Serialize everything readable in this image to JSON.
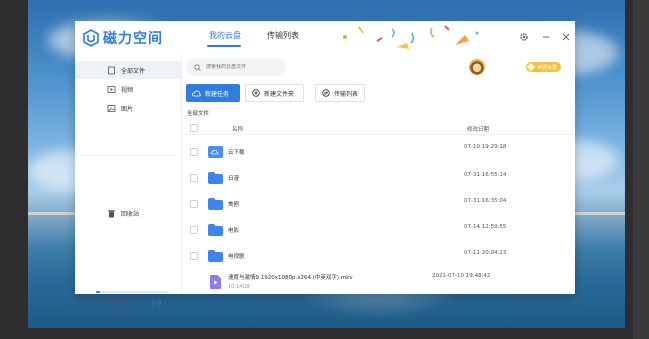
{
  "app": {
    "title": "磁力空间"
  },
  "nav": {
    "tabs": [
      {
        "label": "我的云盘"
      },
      {
        "label": "传输列表"
      }
    ]
  },
  "sidebar": {
    "items": [
      {
        "label": "全部文件"
      },
      {
        "label": "视频"
      },
      {
        "label": "图片"
      },
      {
        "label": "回收站"
      }
    ],
    "storage": {
      "text": "95.03GB/2TB",
      "used_fraction": 0.05,
      "expand_label": "扩容"
    }
  },
  "search": {
    "placeholder": "搜索我的云盘文件"
  },
  "vip": {
    "label": "续费会员"
  },
  "toolbar": {
    "new_task": "新建任务",
    "new_folder": "新建文件夹",
    "transfer_list": "传输列表"
  },
  "breadcrumb": "全部文件",
  "table": {
    "columns": {
      "name": "名称",
      "date": "修改日期"
    },
    "rows": [
      {
        "name": "云下载",
        "date": "07-10 19:29:18",
        "type": "cloud-folder"
      },
      {
        "name": "日漫",
        "date": "07-31 16:55:14",
        "type": "folder"
      },
      {
        "name": "美剧",
        "date": "07-31 16:35:04",
        "type": "folder"
      },
      {
        "name": "电影",
        "date": "07-14 12:59:55",
        "type": "folder"
      },
      {
        "name": "电视剧",
        "date": "07-11 20:04:23",
        "type": "folder"
      },
      {
        "name": "速度与激情9.1920x1080p.x264.(中英双字).mkv",
        "size": "10.14GB",
        "date": "2021-07-10 19:48:42",
        "type": "video"
      }
    ]
  },
  "colors": {
    "accent": "#2f7de1",
    "vip": "#f5c041"
  }
}
